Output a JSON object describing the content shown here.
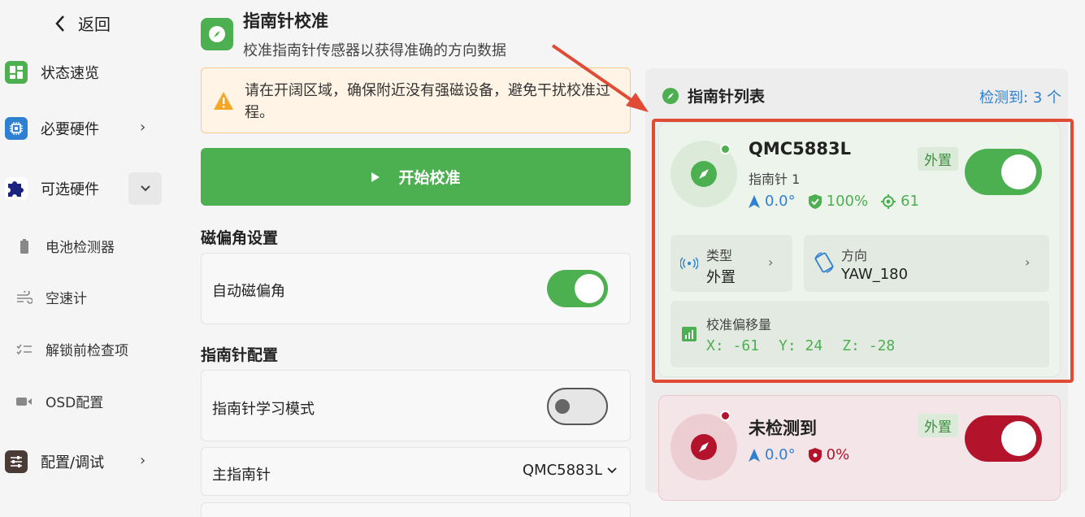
{
  "sidebar": {
    "back_label": "返回",
    "items": [
      {
        "label": "状态速览",
        "icon": "dashboard-icon",
        "color": "#4caf50"
      },
      {
        "label": "必要硬件",
        "icon": "chip-icon",
        "color": "#2f80d1"
      },
      {
        "label": "可选硬件",
        "icon": "puzzle-icon",
        "color": "#1a237e"
      }
    ],
    "sub_items": [
      {
        "label": "电池检测器",
        "icon": "battery-icon"
      },
      {
        "label": "空速计",
        "icon": "wind-icon"
      },
      {
        "label": "解锁前检查项",
        "icon": "checklist-icon"
      },
      {
        "label": "OSD配置",
        "icon": "video-icon"
      }
    ],
    "config_item": {
      "label": "配置/调试",
      "icon": "sliders-icon",
      "color": "#4a3b36"
    }
  },
  "header": {
    "title": "指南针校准",
    "subtitle": "校准指南针传感器以获得准确的方向数据"
  },
  "warning": {
    "text": "请在开阔区域，确保附近没有强磁设备，避免干扰校准过程。"
  },
  "start_button": {
    "label": "开始校准"
  },
  "declination": {
    "section_title": "磁偏角设置",
    "auto_label": "自动磁偏角",
    "auto_enabled": true
  },
  "config": {
    "section_title": "指南针配置",
    "learn_label": "指南针学习模式",
    "learn_enabled": false,
    "primary_label": "主指南针",
    "primary_value": "QMC5883L"
  },
  "compass_list": {
    "title": "指南针列表",
    "detected": "检测到: 3 个",
    "compasses": [
      {
        "name": "QMC5883L",
        "index_label": "指南针 1",
        "badge": "外置",
        "heading": "0.0°",
        "health": "100%",
        "signal": "61",
        "enabled": true,
        "type_label": "类型",
        "type_value": "外置",
        "orientation_label": "方向",
        "orientation_value": "YAW_180",
        "offset_label": "校准偏移量",
        "offset_x": "X: -61",
        "offset_y": "Y: 24",
        "offset_z": "Z: -28"
      },
      {
        "name": "未检测到",
        "badge": "外置",
        "heading": "0.0°",
        "health": "0%",
        "enabled": true
      }
    ]
  },
  "colors": {
    "accent_green": "#4caf50",
    "accent_red": "#b3132b",
    "link_blue": "#2f80d1",
    "annotation_red": "#e04b35"
  }
}
